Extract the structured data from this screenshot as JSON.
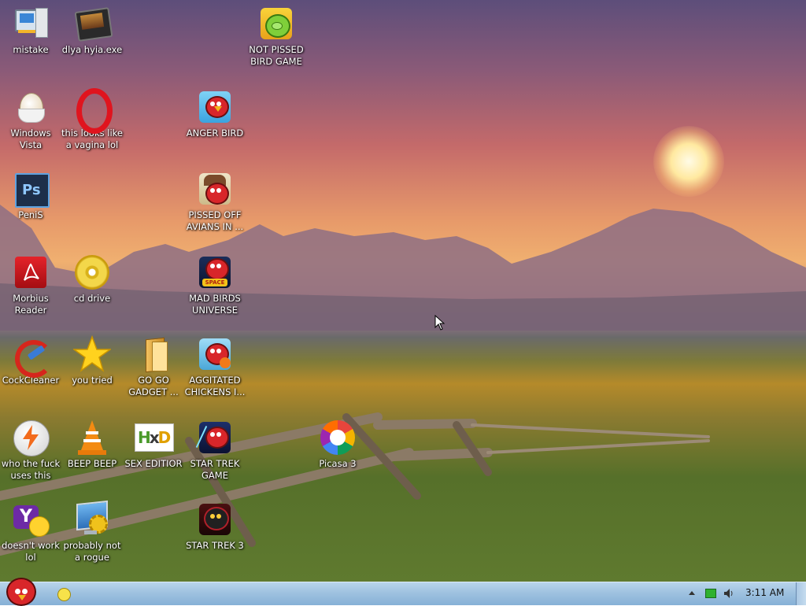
{
  "desktop": {
    "icons": [
      {
        "label": "mistake",
        "icon": "computer-icon"
      },
      {
        "label": "dlya hyia.exe",
        "icon": "video-app-icon"
      },
      {
        "label": "NOT PISSED BIRD GAME",
        "icon": "green-pig-icon"
      },
      {
        "label": "Windows Vista",
        "icon": "egg-icon"
      },
      {
        "label": "this looks like a vagina lol",
        "icon": "opera-icon"
      },
      {
        "label": "ANGER BIRD",
        "icon": "angry-bird-icon"
      },
      {
        "label": "PeniS",
        "icon": "photoshop-icon"
      },
      {
        "label": "PISSED OFF AVIANS IN ...",
        "icon": "angry-birds-seasons-icon"
      },
      {
        "label": "Morbius Reader",
        "icon": "pdf-reader-icon"
      },
      {
        "label": "cd drive",
        "icon": "cd-icon"
      },
      {
        "label": "MAD BIRDS UNIVERSE",
        "icon": "angry-birds-space-icon"
      },
      {
        "label": "CockCleaner",
        "icon": "ccleaner-icon"
      },
      {
        "label": "you tried",
        "icon": "gold-star-icon"
      },
      {
        "label": "GO GO GADGET ...",
        "icon": "folder-icon"
      },
      {
        "label": "AGGITATED CHICKENS I...",
        "icon": "angry-birds-rio-icon"
      },
      {
        "label": "who the fuck uses this",
        "icon": "lightning-icon"
      },
      {
        "label": "BEEP BEEP",
        "icon": "vlc-cone-icon"
      },
      {
        "label": "SEX EDITIOR",
        "icon": "hxd-editor-icon"
      },
      {
        "label": "STAR TREK GAME",
        "icon": "angry-birds-star-wars-icon"
      },
      {
        "label": "Picasa 3",
        "icon": "picasa-icon"
      },
      {
        "label": "doesn't work lol",
        "icon": "yahoo-messenger-icon"
      },
      {
        "label": "probably not a rogue",
        "icon": "monitor-gears-icon"
      },
      {
        "label": "STAR TREK 3",
        "icon": "angry-birds-star-wars-2-icon"
      }
    ]
  },
  "taskbar": {
    "start": "angry-bird-start-icon",
    "quick_launch": "sticky-notes-icon",
    "tray": {
      "icons": [
        "show-hidden-icons-arrow",
        "network-icon",
        "volume-icon"
      ],
      "clock": "3:11 AM"
    }
  },
  "colors": {
    "taskbar": "#9fc2e0",
    "label_text": "#ffffff"
  }
}
